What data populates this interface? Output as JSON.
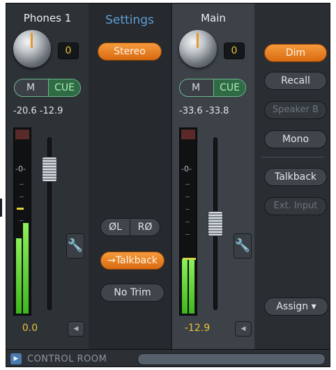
{
  "phones": {
    "title": "Phones  1",
    "knob_value": "0",
    "mute_label": "M",
    "cue_label": "CUE",
    "level_left": "-20.6",
    "level_right": "-12.9",
    "scale_zero": "-0-",
    "gain_value": "0.0",
    "wrench_icon": "wrench-icon",
    "collapse_icon": "triangle-left-icon"
  },
  "settings": {
    "title": "Settings",
    "stereo_label": "Stereo",
    "phase_left_label": "ØL",
    "phase_right_label": "RØ",
    "talkback_label": "→Talkback",
    "notrim_label": "No Trim"
  },
  "main": {
    "title": "Main",
    "knob_value": "0",
    "mute_label": "M",
    "cue_label": "CUE",
    "level_left": "-33.6",
    "level_right": "-33.8",
    "scale_zero": "-0-",
    "gain_value": "-12.9",
    "wrench_icon": "wrench-icon",
    "collapse_icon": "triangle-left-icon"
  },
  "controls": {
    "dim_label": "Dim",
    "recall_label": "Recall",
    "speakerb_label": "Speaker B",
    "mono_label": "Mono",
    "talkback_label": "Talkback",
    "extinput_label": "Ext. Input",
    "assign_label": "Assign ▾"
  },
  "bottom_bar": {
    "expand_icon": "triangle-right-icon",
    "label": "CONTROL ROOM"
  },
  "colors": {
    "accent_orange": "#e8801f",
    "cue_green": "#2f6b45",
    "value_yellow": "#e8c23a",
    "settings_blue": "#5e9fd8",
    "meter_green": "#5fd43a"
  }
}
